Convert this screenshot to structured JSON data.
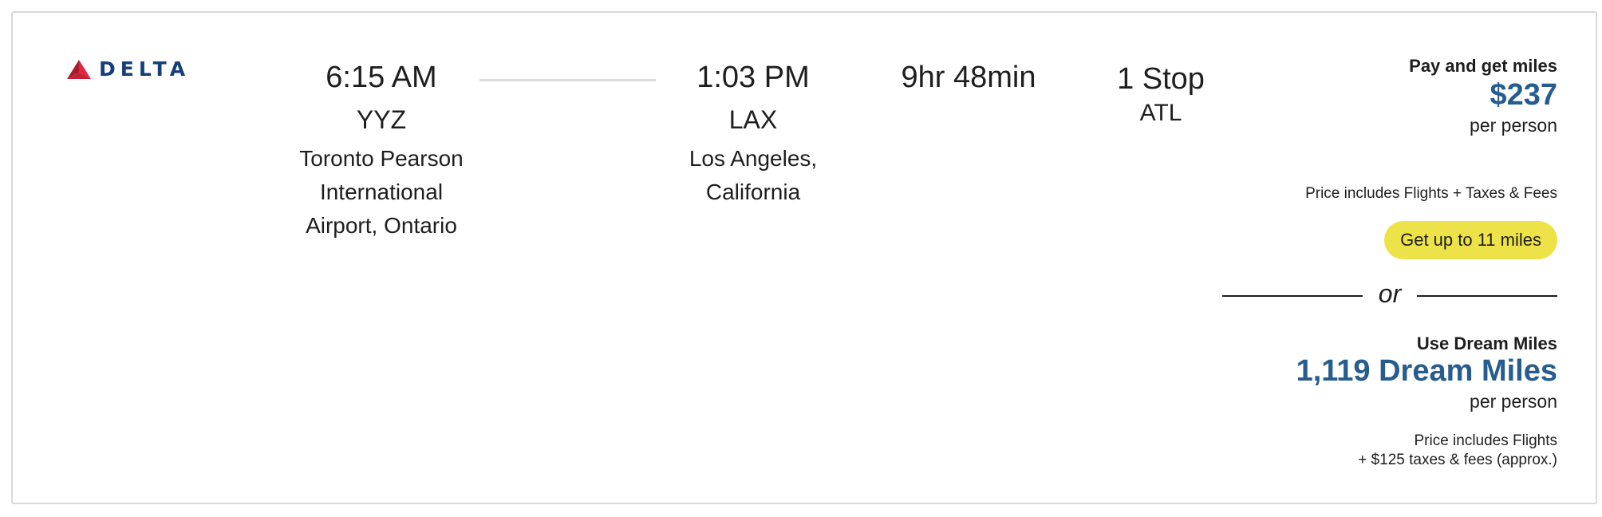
{
  "airline": {
    "name": "DELTA",
    "logo_icon": "delta-widget-icon",
    "colors": {
      "wordmark": "#163e78",
      "widget_dark": "#a61c2e",
      "widget_light": "#e3263b"
    }
  },
  "departure": {
    "time": "6:15 AM",
    "code": "YYZ",
    "city_line1": "Toronto Pearson",
    "city_line2": "International",
    "city_line3": "Airport, Ontario"
  },
  "arrival": {
    "time": "1:03 PM",
    "code": "LAX",
    "city_line1": "Los Angeles,",
    "city_line2": "California"
  },
  "duration": "9hr 48min",
  "stops": {
    "count": "1 Stop",
    "via": "ATL"
  },
  "pricing": {
    "pay_title": "Pay and get miles",
    "price": "$237",
    "per_person": "per person",
    "includes": "Price includes Flights + Taxes & Fees",
    "miles_button": "Get up to 11 miles",
    "or": "or",
    "dream_title": "Use Dream Miles",
    "dream_miles": "1,119 Dream Miles",
    "dream_per_person": "per person",
    "dream_includes_line1": "Price includes Flights",
    "dream_includes_line2": "+ $125 taxes & fees (approx.)",
    "colors": {
      "price": "#275c8e",
      "button": "#ede349"
    }
  }
}
